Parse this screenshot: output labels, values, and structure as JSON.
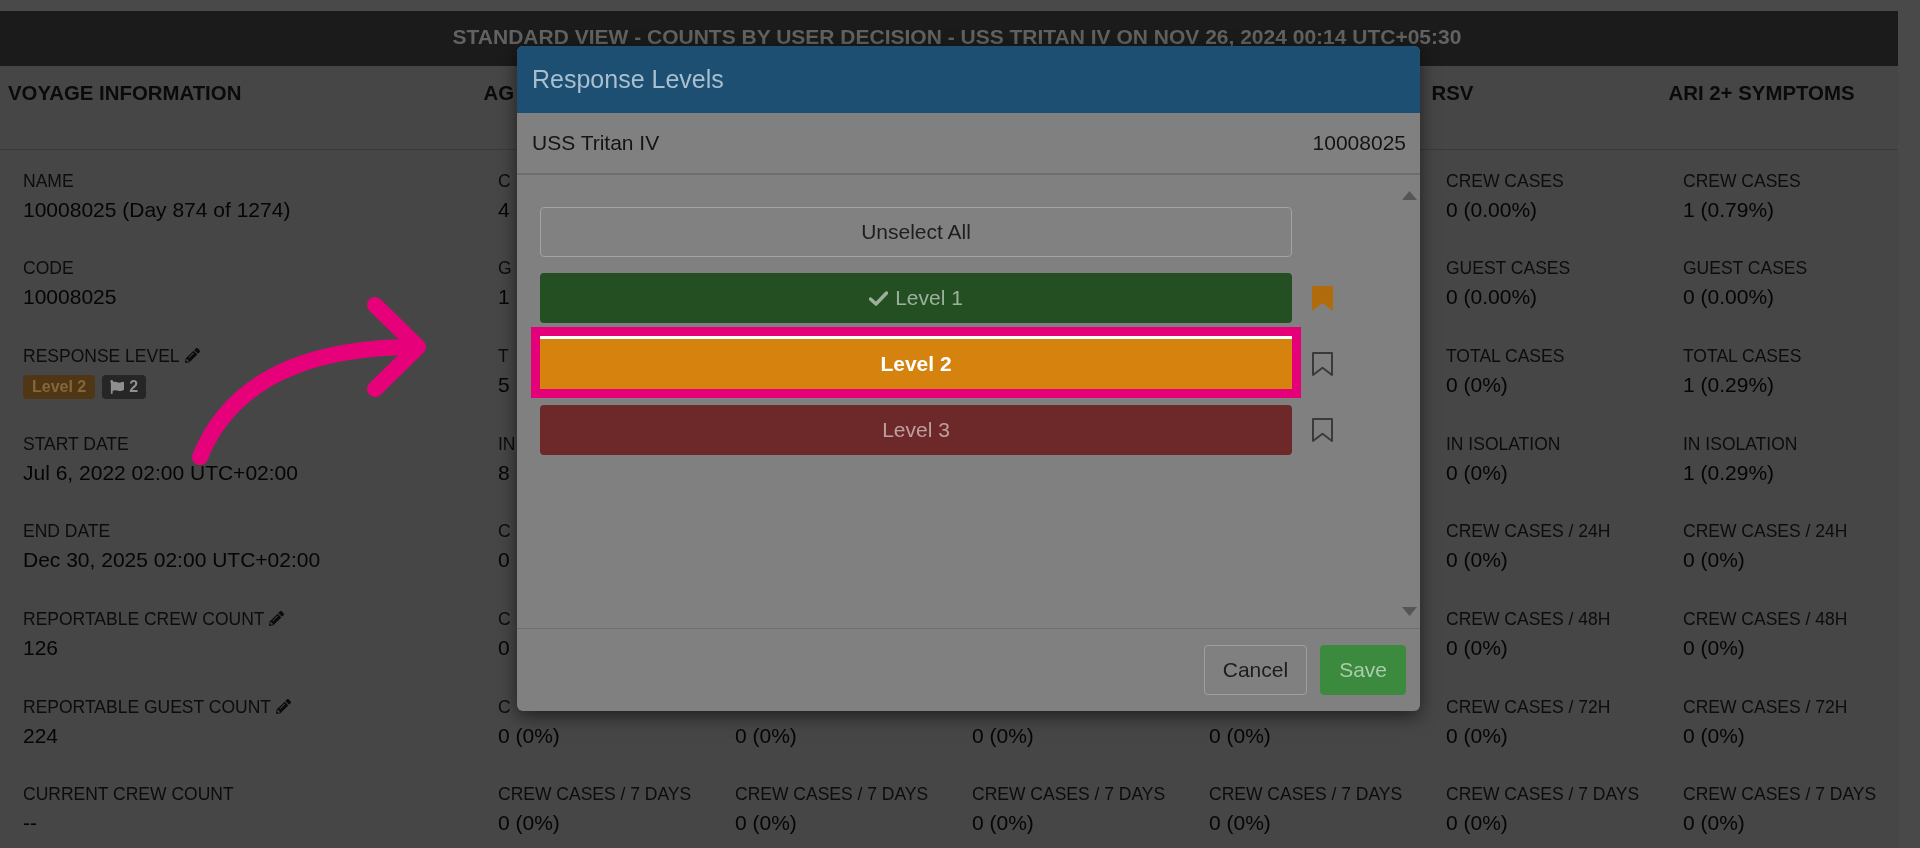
{
  "banner": {
    "title": "STANDARD VIEW - COUNTS BY USER DECISION - USS TRITAN IV ON NOV 26, 2024 00:14 UTC+05:30"
  },
  "voyage_information": {
    "header": "VOYAGE INFORMATION",
    "fields": [
      {
        "kind": "text",
        "label": "NAME",
        "editable": false,
        "value": "10008025 (Day 874 of 1274)"
      },
      {
        "kind": "text",
        "label": "CODE",
        "editable": false,
        "value": "10008025"
      },
      {
        "kind": "badges",
        "label": "RESPONSE LEVEL",
        "editable": true,
        "badges": [
          {
            "kind": "level",
            "text": "Level 2"
          },
          {
            "kind": "flag",
            "text": "2"
          }
        ]
      },
      {
        "kind": "text",
        "label": "START DATE",
        "editable": false,
        "value": "Jul 6, 2022 02:00 UTC+02:00"
      },
      {
        "kind": "text",
        "label": "END DATE",
        "editable": false,
        "value": "Dec 30, 2025 02:00 UTC+02:00"
      },
      {
        "kind": "text",
        "label": "REPORTABLE CREW COUNT",
        "editable": true,
        "value": "126"
      },
      {
        "kind": "text",
        "label": "REPORTABLE GUEST COUNT",
        "editable": true,
        "value": "224"
      },
      {
        "kind": "text",
        "label": "CURRENT CREW COUNT",
        "editable": false,
        "value": "--"
      }
    ]
  },
  "stat_columns": [
    {
      "header": "AG",
      "cells": [
        {
          "label": "C",
          "value": "4"
        },
        {
          "label": "G",
          "value": "1"
        },
        {
          "label": "T",
          "value": "5"
        },
        {
          "label": "IN",
          "value": "8"
        },
        {
          "label": "C",
          "value": "0"
        },
        {
          "label": "C",
          "value": "0"
        },
        {
          "label": "C",
          "value": "0 (0%)"
        },
        {
          "label": "CREW CASES / 7 DAYS",
          "value": "0 (0%)"
        }
      ]
    },
    {
      "cells": [
        {
          "value": "0 (0%)"
        },
        {
          "label": "CREW CASES / 7 DAYS",
          "value": "0 (0%)"
        }
      ]
    },
    {
      "cells": [
        {
          "value": "0 (0%)"
        },
        {
          "label": "CREW CASES / 7 DAYS",
          "value": "0 (0%)"
        }
      ]
    },
    {
      "cells": [
        {
          "value": "0 (0%)"
        },
        {
          "label": "CREW CASES / 7 DAYS",
          "value": "0 (0%)"
        }
      ]
    },
    {
      "header": "RSV",
      "cells": [
        {
          "label": "CREW CASES",
          "value": "0 (0.00%)"
        },
        {
          "label": "GUEST CASES",
          "value": "0 (0.00%)"
        },
        {
          "label": "TOTAL CASES",
          "value": "0 (0%)"
        },
        {
          "label": "IN ISOLATION",
          "value": "0 (0%)"
        },
        {
          "label": "CREW CASES / 24H",
          "value": "0 (0%)"
        },
        {
          "label": "CREW CASES / 48H",
          "value": "0 (0%)"
        },
        {
          "label": "CREW CASES / 72H",
          "value": "0 (0%)"
        },
        {
          "label": "CREW CASES / 7 DAYS",
          "value": "0 (0%)"
        }
      ]
    },
    {
      "header": "ARI 2+ SYMPTOMS",
      "cells": [
        {
          "label": "CREW CASES",
          "value": "1 (0.79%)"
        },
        {
          "label": "GUEST CASES",
          "value": "0 (0.00%)"
        },
        {
          "label": "TOTAL CASES",
          "value": "1 (0.29%)"
        },
        {
          "label": "IN ISOLATION",
          "value": "1 (0.29%)"
        },
        {
          "label": "CREW CASES / 24H",
          "value": "0 (0%)"
        },
        {
          "label": "CREW CASES / 48H",
          "value": "0 (0%)"
        },
        {
          "label": "CREW CASES / 72H",
          "value": "0 (0%)"
        },
        {
          "label": "CREW CASES / 7 DAYS",
          "value": "0 (0%)"
        }
      ]
    }
  ],
  "modal": {
    "title": "Response Levels",
    "vessel": "USS Tritan IV",
    "code": "10008025",
    "unselect_label": "Unselect All",
    "levels": [
      {
        "label": "Level 1",
        "color": "#244f22",
        "checked": true,
        "bookmarked": true,
        "highlighted": false
      },
      {
        "label": "Level 2",
        "color": "#d5820f",
        "checked": false,
        "bookmarked": false,
        "highlighted": true
      },
      {
        "label": "Level 3",
        "color": "#6d2829",
        "checked": false,
        "bookmarked": false,
        "highlighted": false
      }
    ],
    "buttons": [
      {
        "kind": "cancel",
        "label": "Cancel"
      },
      {
        "kind": "save",
        "label": "Save"
      }
    ]
  }
}
